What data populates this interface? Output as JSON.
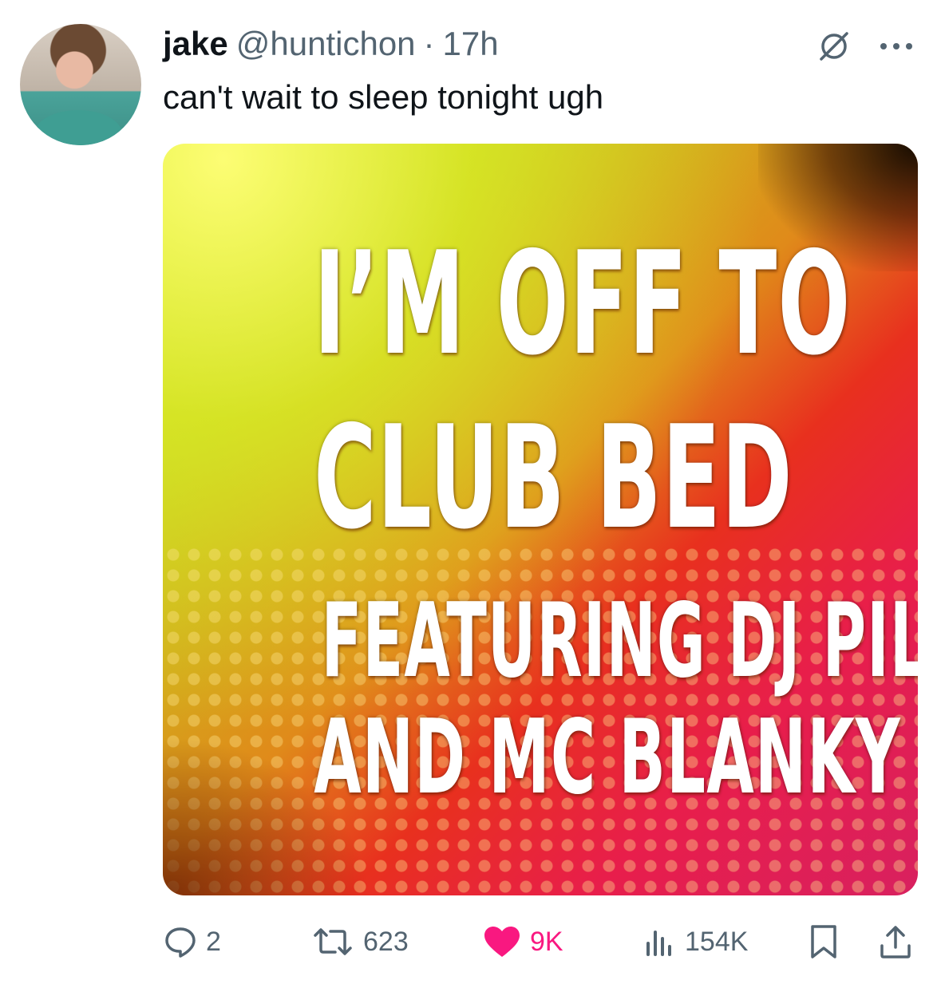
{
  "tweet": {
    "author_name": "jake",
    "handle": "@huntichon",
    "separator": "·",
    "time": "17h",
    "text": "can't wait to sleep tonight ugh"
  },
  "media": {
    "lines": [
      "I’M OFF TO",
      "CLUB BED",
      "FEATURING DJ PILLOW",
      "AND MC BLANKY"
    ]
  },
  "actions": {
    "replies": "2",
    "reposts": "623",
    "likes": "9K",
    "views": "154K"
  },
  "icons": {
    "top": [
      "grok-icon",
      "more-icon"
    ],
    "actions": [
      "reply-icon",
      "repost-icon",
      "like-icon",
      "views-icon",
      "bookmark-icon",
      "share-icon"
    ]
  },
  "colors": {
    "text": "#0f1419",
    "muted": "#536471",
    "like": "#f91880"
  }
}
